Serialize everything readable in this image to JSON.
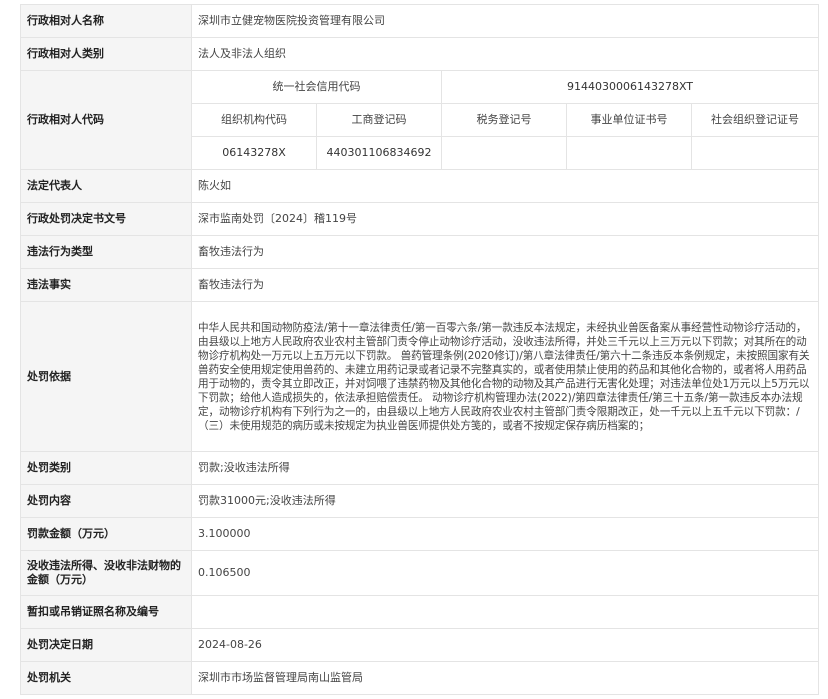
{
  "record": {
    "party_name": {
      "label": "行政相对人名称",
      "value": "深圳市立健宠物医院投资管理有限公司"
    },
    "party_type": {
      "label": "行政相对人类别",
      "value": "法人及非法人组织"
    },
    "party_code": {
      "label": "行政相对人代码",
      "uscc_label": "统一社会信用代码",
      "uscc_value": "9144030006143278XT",
      "org_code_label": "组织机构代码",
      "business_reg_label": "工商登记码",
      "tax_reg_label": "税务登记号",
      "institution_cert_label": "事业单位证书号",
      "social_org_cert_label": "社会组织登记证号",
      "org_code_value": "06143278X",
      "business_reg_value": "440301106834692",
      "tax_reg_value": "",
      "institution_cert_value": "",
      "social_org_cert_value": ""
    },
    "legal_rep": {
      "label": "法定代表人",
      "value": "陈火如"
    },
    "decision_no": {
      "label": "行政处罚决定书文号",
      "value": "深市监南处罚〔2024〕稽119号"
    },
    "violation_type": {
      "label": "违法行为类型",
      "value": "畜牧违法行为"
    },
    "violation_fact": {
      "label": "违法事实",
      "value": "畜牧违法行为"
    },
    "penalty_basis": {
      "label": "处罚依据",
      "value": "中华人民共和国动物防疫法/第十一章法律责任/第一百零六条/第一款违反本法规定，未经执业兽医备案从事经营性动物诊疗活动的，由县级以上地方人民政府农业农村主管部门责令停止动物诊疗活动，没收违法所得，并处三千元以上三万元以下罚款；对其所在的动物诊疗机构处一万元以上五万元以下罚款。 兽药管理条例(2020修订)/第八章法律责任/第六十二条违反本条例规定，未按照国家有关兽药安全使用规定使用兽药的、未建立用药记录或者记录不完整真实的，或者使用禁止使用的药品和其他化合物的，或者将人用药品用于动物的，责令其立即改正，并对饲喂了违禁药物及其他化合物的动物及其产品进行无害化处理；对违法单位处1万元以上5万元以下罚款；给他人造成损失的，依法承担赔偿责任。 动物诊疗机构管理办法(2022)/第四章法律责任/第三十五条/第一款违反本办法规定，动物诊疗机构有下列行为之一的，由县级以上地方人民政府农业农村主管部门责令限期改正，处一千元以上五千元以下罚款：/（三）未使用规范的病历或未按规定为执业兽医师提供处方笺的，或者不按规定保存病历档案的；"
    },
    "penalty_category": {
      "label": "处罚类别",
      "value": "罚款;没收违法所得"
    },
    "penalty_content": {
      "label": "处罚内容",
      "value": "罚款31000元;没收违法所得"
    },
    "fine_amount": {
      "label": "罚款金额（万元）",
      "value": "3.100000"
    },
    "confiscation": {
      "label": "没收违法所得、没收非法财物的金额（万元）",
      "value": "0.106500"
    },
    "license_revoked": {
      "label": "暂扣或吊销证照名称及编号",
      "value": ""
    },
    "decision_date": {
      "label": "处罚决定日期",
      "value": "2024-08-26"
    },
    "authority": {
      "label": "处罚机关",
      "value": "深圳市市场监督管理局南山监管局"
    }
  }
}
